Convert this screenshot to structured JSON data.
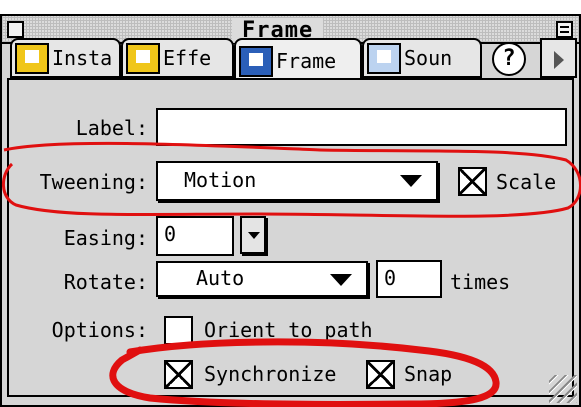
{
  "window": {
    "title": "Frame"
  },
  "tabs": [
    {
      "label": "Insta"
    },
    {
      "label": "Effe"
    },
    {
      "label": "Frame"
    },
    {
      "label": "Soun"
    }
  ],
  "help_label": "?",
  "form": {
    "label_caption": "Label:",
    "label_value": "",
    "tweening_caption": "Tweening:",
    "tweening_value": "Motion",
    "scale_label": "Scale",
    "scale_checked": true,
    "easing_caption": "Easing:",
    "easing_value": "0",
    "rotate_caption": "Rotate:",
    "rotate_value": "Auto",
    "times_value": "0",
    "times_label": "times",
    "options_caption": "Options:",
    "orient_label": "Orient to path",
    "orient_checked": false,
    "synchronize_label": "Synchronize",
    "synchronize_checked": true,
    "snap_label": "Snap",
    "snap_checked": true
  },
  "colors": {
    "annotation": "#e01010",
    "icon_blue": "#2b5fb8",
    "icon_yellow": "#f0c619"
  }
}
